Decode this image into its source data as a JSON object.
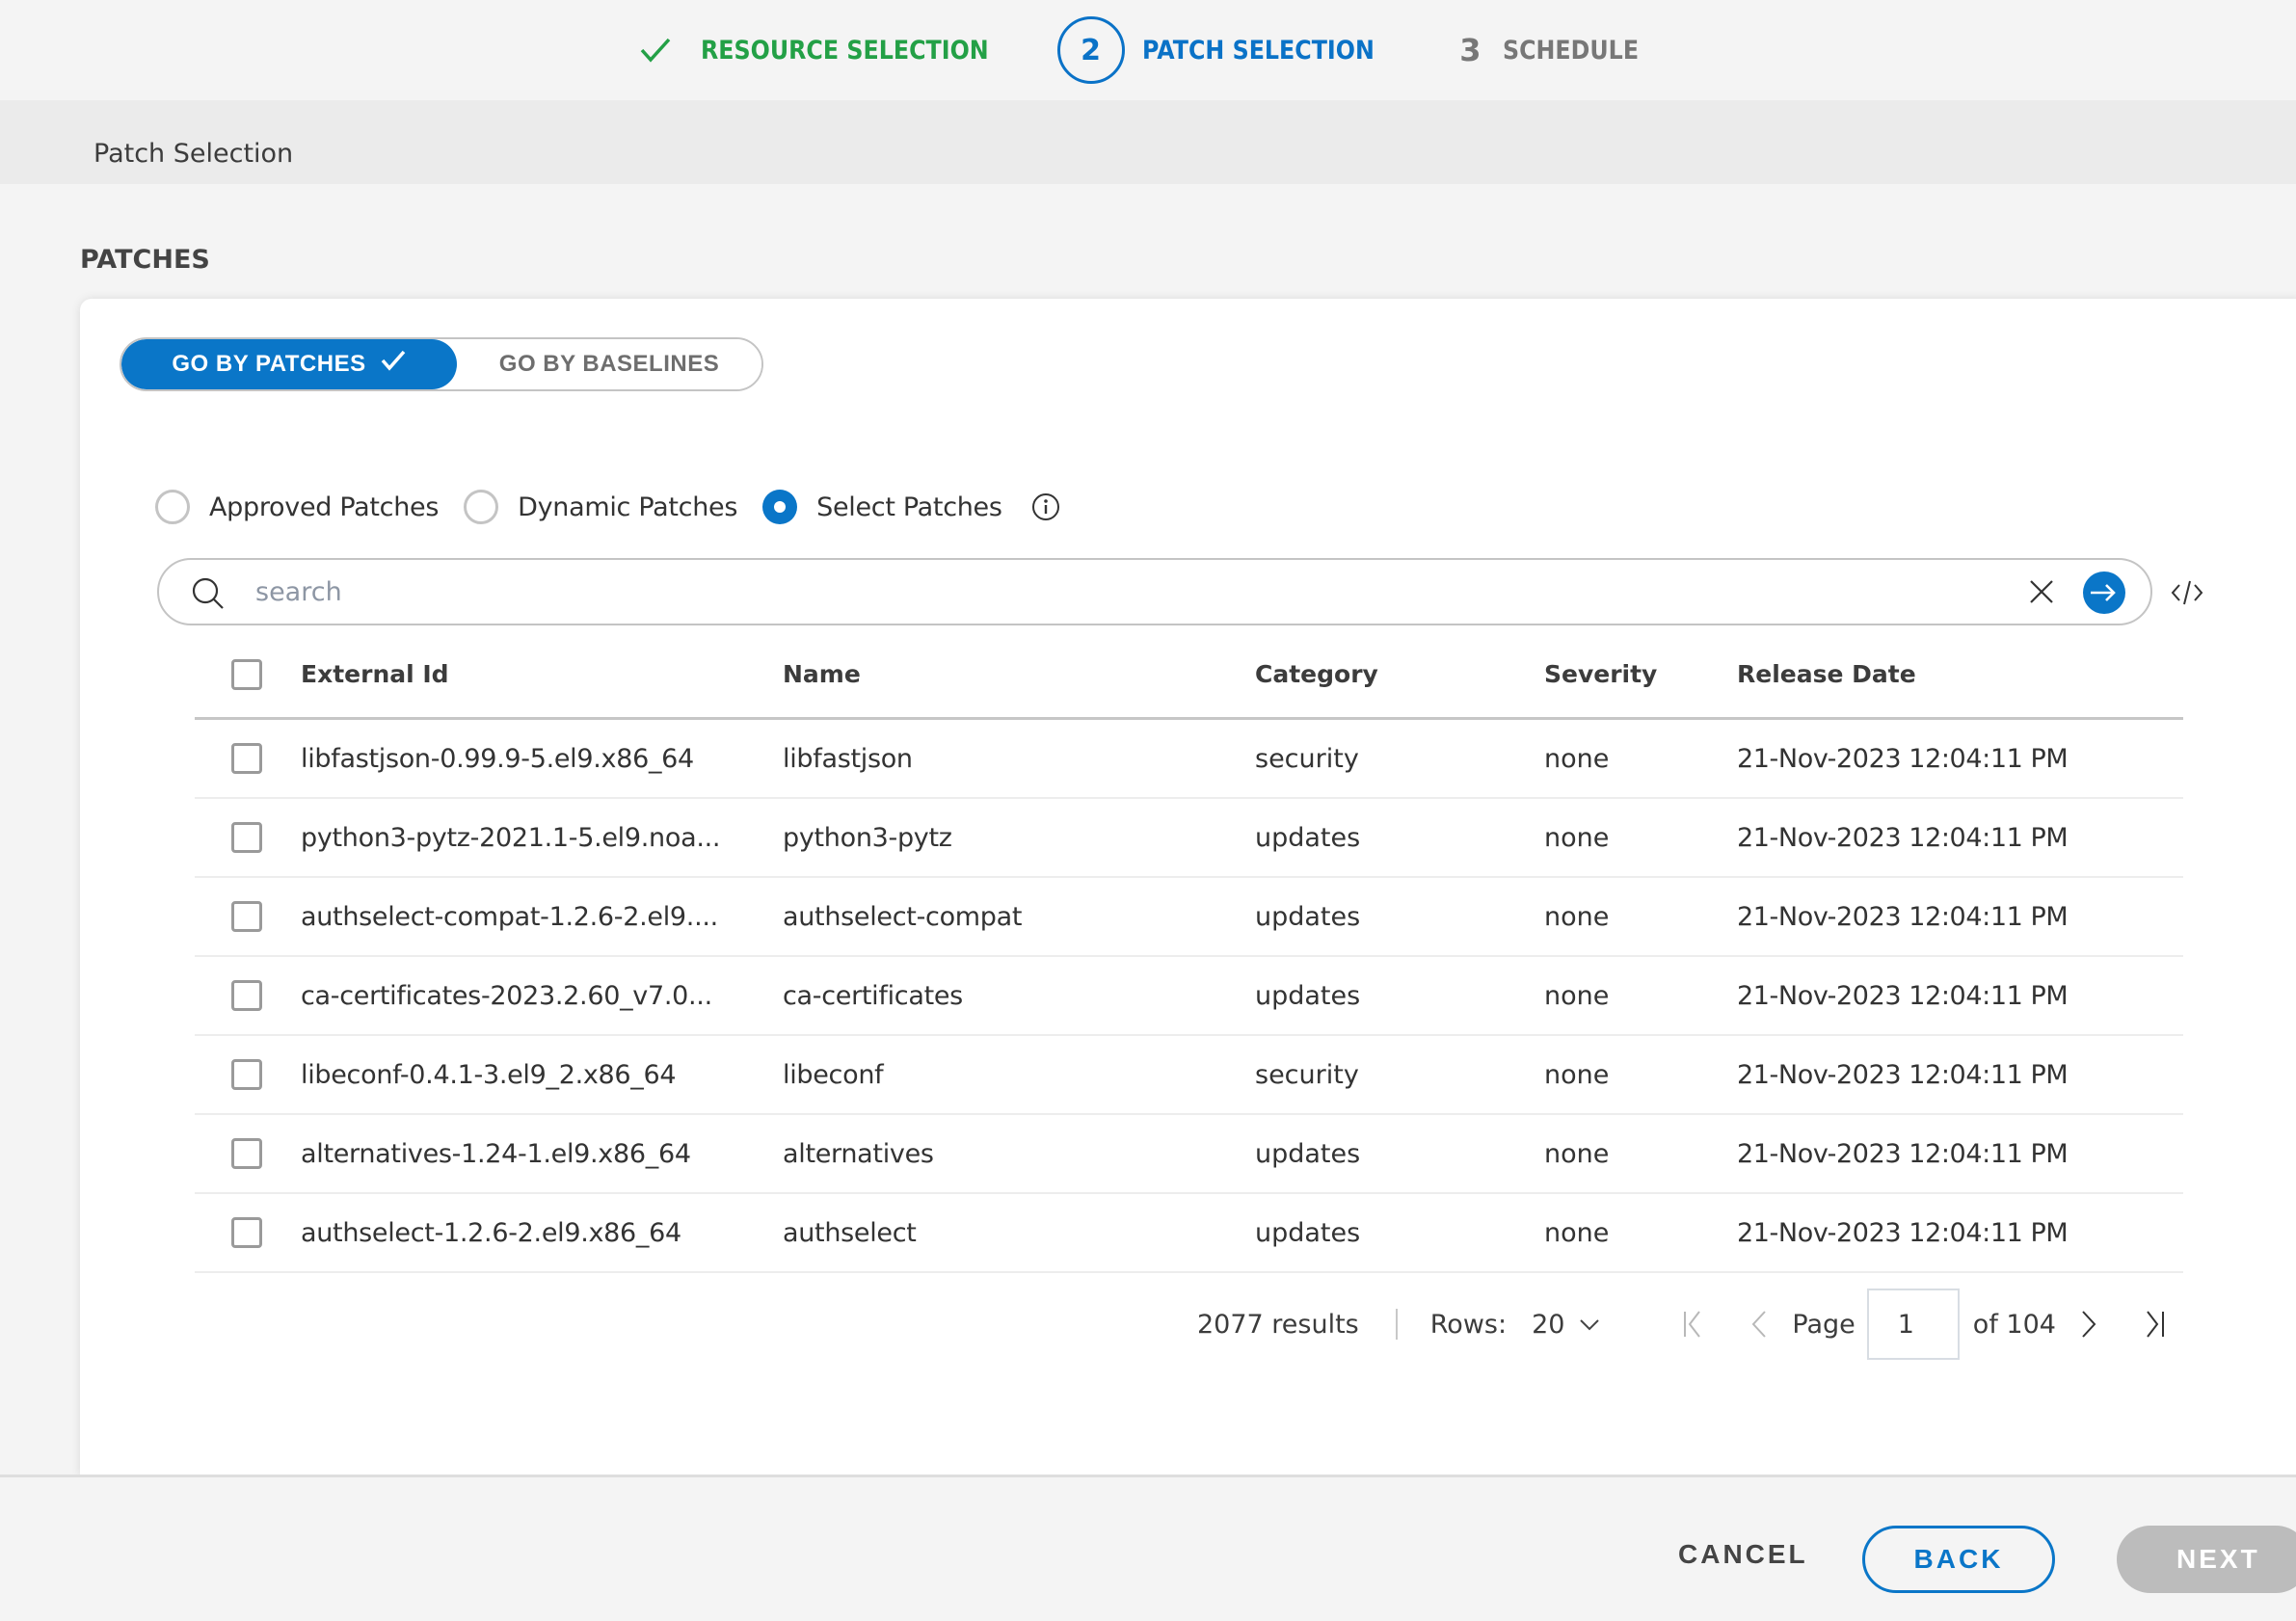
{
  "stepper": {
    "steps": [
      {
        "label": "RESOURCE SELECTION",
        "status": "complete",
        "icon": "check-icon"
      },
      {
        "number": "2",
        "label": "PATCH SELECTION",
        "status": "active"
      },
      {
        "number": "3",
        "label": "SCHEDULE",
        "status": "pending"
      }
    ],
    "colors": {
      "complete": "#23a046",
      "active": "#0a72c7",
      "pending": "#777777"
    }
  },
  "section": {
    "title": "Patch Selection"
  },
  "patches": {
    "heading": "PATCHES",
    "toggle": {
      "options": [
        {
          "label": "GO BY PATCHES",
          "selected": true
        },
        {
          "label": "GO BY BASELINES",
          "selected": false
        }
      ]
    },
    "radios": [
      {
        "label": "Approved Patches",
        "checked": false
      },
      {
        "label": "Dynamic Patches",
        "checked": false
      },
      {
        "label": "Select Patches",
        "checked": true
      }
    ],
    "search": {
      "placeholder": "search",
      "value": ""
    },
    "table": {
      "columns": [
        "External Id",
        "Name",
        "Category",
        "Severity",
        "Release Date"
      ],
      "rows": [
        {
          "external_id": "libfastjson-0.99.9-5.el9.x86_64",
          "name": "libfastjson",
          "category": "security",
          "severity": "none",
          "release_date": "21-Nov-2023 12:04:11 PM"
        },
        {
          "external_id": "python3-pytz-2021.1-5.el9.noa...",
          "name": "python3-pytz",
          "category": "updates",
          "severity": "none",
          "release_date": "21-Nov-2023 12:04:11 PM"
        },
        {
          "external_id": "authselect-compat-1.2.6-2.el9....",
          "name": "authselect-compat",
          "category": "updates",
          "severity": "none",
          "release_date": "21-Nov-2023 12:04:11 PM"
        },
        {
          "external_id": "ca-certificates-2023.2.60_v7.0...",
          "name": "ca-certificates",
          "category": "updates",
          "severity": "none",
          "release_date": "21-Nov-2023 12:04:11 PM"
        },
        {
          "external_id": "libeconf-0.4.1-3.el9_2.x86_64",
          "name": "libeconf",
          "category": "security",
          "severity": "none",
          "release_date": "21-Nov-2023 12:04:11 PM"
        },
        {
          "external_id": "alternatives-1.24-1.el9.x86_64",
          "name": "alternatives",
          "category": "updates",
          "severity": "none",
          "release_date": "21-Nov-2023 12:04:11 PM"
        },
        {
          "external_id": "authselect-1.2.6-2.el9.x86_64",
          "name": "authselect",
          "category": "updates",
          "severity": "none",
          "release_date": "21-Nov-2023 12:04:11 PM"
        }
      ]
    },
    "pagination": {
      "results": "2077 results",
      "rows_label": "Rows:",
      "rows_value": "20",
      "page_label": "Page",
      "page_value": "1",
      "of_label": "of 104"
    }
  },
  "footer": {
    "cancel": "CANCEL",
    "back": "BACK",
    "next": "NEXT"
  },
  "colors": {
    "accent": "#0a76c8",
    "success": "#23a046",
    "disabled": "#bcbcbc"
  }
}
